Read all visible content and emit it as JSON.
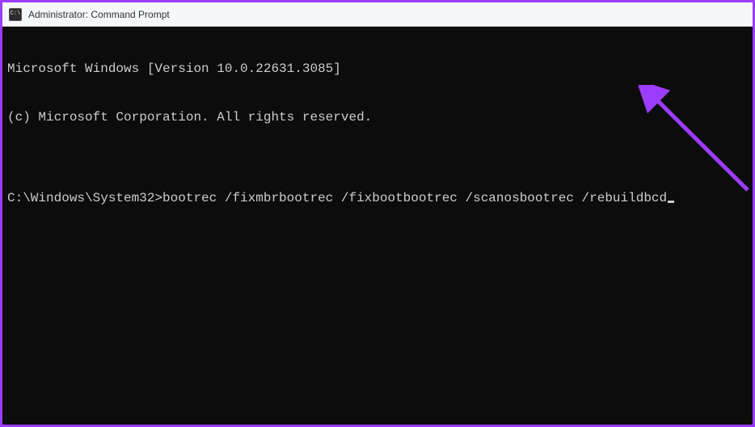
{
  "window": {
    "title": "Administrator: Command Prompt",
    "icon_label": "C:\\"
  },
  "terminal": {
    "line1": "Microsoft Windows [Version 10.0.22631.3085]",
    "line2": "(c) Microsoft Corporation. All rights reserved.",
    "blank": "",
    "prompt": "C:\\Windows\\System32>",
    "command": "bootrec /fixmbrbootrec /fixbootbootrec /scanosbootrec /rebuildbcd"
  },
  "annotation": {
    "color": "#9c3cff"
  }
}
